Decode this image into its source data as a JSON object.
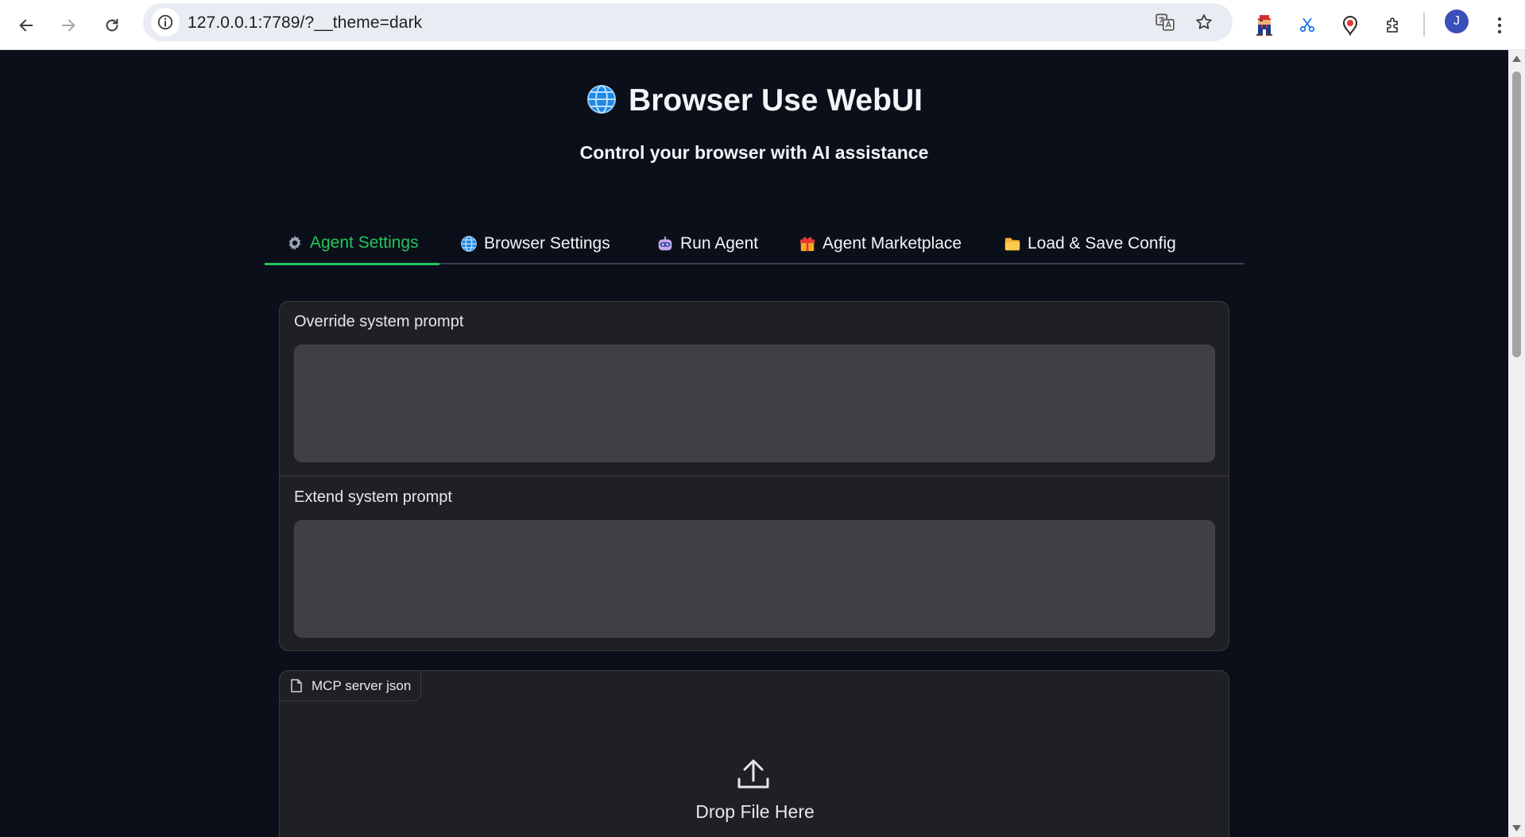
{
  "browser": {
    "url": "127.0.0.1:7789/?__theme=dark",
    "avatar_initial": "J"
  },
  "app": {
    "title": "Browser Use WebUI",
    "subtitle": "Control your browser with AI assistance"
  },
  "tabs": [
    {
      "label": "Agent Settings",
      "icon": "gear-icon",
      "active": true
    },
    {
      "label": "Browser Settings",
      "icon": "globe-icon",
      "active": false
    },
    {
      "label": "Run Agent",
      "icon": "robot-icon",
      "active": false
    },
    {
      "label": "Agent Marketplace",
      "icon": "gift-icon",
      "active": false
    },
    {
      "label": "Load & Save Config",
      "icon": "folder-icon",
      "active": false
    }
  ],
  "form": {
    "override_label": "Override system prompt",
    "override_value": "",
    "extend_label": "Extend system prompt",
    "extend_value": ""
  },
  "upload": {
    "label": "MCP server json",
    "drop_text": "Drop File Here"
  },
  "colors": {
    "accent": "#22c55e",
    "background": "#0b0f19",
    "panel": "#1f2023",
    "input": "#3f4046"
  }
}
